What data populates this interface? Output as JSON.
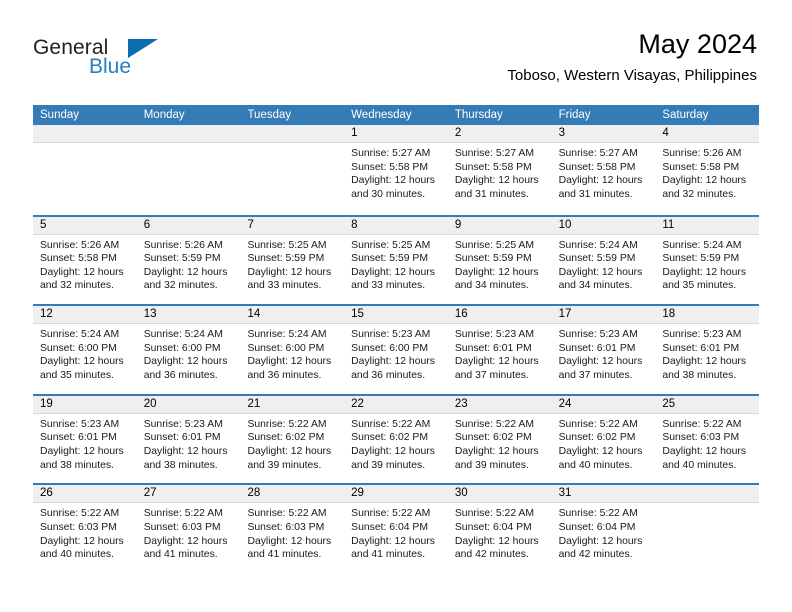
{
  "logo": {
    "word_top": "General",
    "word_bottom": "Blue",
    "accent_color": "#0b6cb0",
    "text_color": "#231f20"
  },
  "header": {
    "title": "May 2024",
    "subtitle": "Toboso, Western Visayas, Philippines"
  },
  "theme": {
    "header_blue": "#357cb6",
    "band_gray": "#efefef"
  },
  "weekdays": [
    "Sunday",
    "Monday",
    "Tuesday",
    "Wednesday",
    "Thursday",
    "Friday",
    "Saturday"
  ],
  "weeks": [
    [
      {
        "day": "",
        "sunrise": "",
        "sunset": "",
        "daylight": "",
        "daylight2": ""
      },
      {
        "day": "",
        "sunrise": "",
        "sunset": "",
        "daylight": "",
        "daylight2": ""
      },
      {
        "day": "",
        "sunrise": "",
        "sunset": "",
        "daylight": "",
        "daylight2": ""
      },
      {
        "day": "1",
        "sunrise": "Sunrise: 5:27 AM",
        "sunset": "Sunset: 5:58 PM",
        "daylight": "Daylight: 12 hours",
        "daylight2": "and 30 minutes."
      },
      {
        "day": "2",
        "sunrise": "Sunrise: 5:27 AM",
        "sunset": "Sunset: 5:58 PM",
        "daylight": "Daylight: 12 hours",
        "daylight2": "and 31 minutes."
      },
      {
        "day": "3",
        "sunrise": "Sunrise: 5:27 AM",
        "sunset": "Sunset: 5:58 PM",
        "daylight": "Daylight: 12 hours",
        "daylight2": "and 31 minutes."
      },
      {
        "day": "4",
        "sunrise": "Sunrise: 5:26 AM",
        "sunset": "Sunset: 5:58 PM",
        "daylight": "Daylight: 12 hours",
        "daylight2": "and 32 minutes."
      }
    ],
    [
      {
        "day": "5",
        "sunrise": "Sunrise: 5:26 AM",
        "sunset": "Sunset: 5:58 PM",
        "daylight": "Daylight: 12 hours",
        "daylight2": "and 32 minutes."
      },
      {
        "day": "6",
        "sunrise": "Sunrise: 5:26 AM",
        "sunset": "Sunset: 5:59 PM",
        "daylight": "Daylight: 12 hours",
        "daylight2": "and 32 minutes."
      },
      {
        "day": "7",
        "sunrise": "Sunrise: 5:25 AM",
        "sunset": "Sunset: 5:59 PM",
        "daylight": "Daylight: 12 hours",
        "daylight2": "and 33 minutes."
      },
      {
        "day": "8",
        "sunrise": "Sunrise: 5:25 AM",
        "sunset": "Sunset: 5:59 PM",
        "daylight": "Daylight: 12 hours",
        "daylight2": "and 33 minutes."
      },
      {
        "day": "9",
        "sunrise": "Sunrise: 5:25 AM",
        "sunset": "Sunset: 5:59 PM",
        "daylight": "Daylight: 12 hours",
        "daylight2": "and 34 minutes."
      },
      {
        "day": "10",
        "sunrise": "Sunrise: 5:24 AM",
        "sunset": "Sunset: 5:59 PM",
        "daylight": "Daylight: 12 hours",
        "daylight2": "and 34 minutes."
      },
      {
        "day": "11",
        "sunrise": "Sunrise: 5:24 AM",
        "sunset": "Sunset: 5:59 PM",
        "daylight": "Daylight: 12 hours",
        "daylight2": "and 35 minutes."
      }
    ],
    [
      {
        "day": "12",
        "sunrise": "Sunrise: 5:24 AM",
        "sunset": "Sunset: 6:00 PM",
        "daylight": "Daylight: 12 hours",
        "daylight2": "and 35 minutes."
      },
      {
        "day": "13",
        "sunrise": "Sunrise: 5:24 AM",
        "sunset": "Sunset: 6:00 PM",
        "daylight": "Daylight: 12 hours",
        "daylight2": "and 36 minutes."
      },
      {
        "day": "14",
        "sunrise": "Sunrise: 5:24 AM",
        "sunset": "Sunset: 6:00 PM",
        "daylight": "Daylight: 12 hours",
        "daylight2": "and 36 minutes."
      },
      {
        "day": "15",
        "sunrise": "Sunrise: 5:23 AM",
        "sunset": "Sunset: 6:00 PM",
        "daylight": "Daylight: 12 hours",
        "daylight2": "and 36 minutes."
      },
      {
        "day": "16",
        "sunrise": "Sunrise: 5:23 AM",
        "sunset": "Sunset: 6:01 PM",
        "daylight": "Daylight: 12 hours",
        "daylight2": "and 37 minutes."
      },
      {
        "day": "17",
        "sunrise": "Sunrise: 5:23 AM",
        "sunset": "Sunset: 6:01 PM",
        "daylight": "Daylight: 12 hours",
        "daylight2": "and 37 minutes."
      },
      {
        "day": "18",
        "sunrise": "Sunrise: 5:23 AM",
        "sunset": "Sunset: 6:01 PM",
        "daylight": "Daylight: 12 hours",
        "daylight2": "and 38 minutes."
      }
    ],
    [
      {
        "day": "19",
        "sunrise": "Sunrise: 5:23 AM",
        "sunset": "Sunset: 6:01 PM",
        "daylight": "Daylight: 12 hours",
        "daylight2": "and 38 minutes."
      },
      {
        "day": "20",
        "sunrise": "Sunrise: 5:23 AM",
        "sunset": "Sunset: 6:01 PM",
        "daylight": "Daylight: 12 hours",
        "daylight2": "and 38 minutes."
      },
      {
        "day": "21",
        "sunrise": "Sunrise: 5:22 AM",
        "sunset": "Sunset: 6:02 PM",
        "daylight": "Daylight: 12 hours",
        "daylight2": "and 39 minutes."
      },
      {
        "day": "22",
        "sunrise": "Sunrise: 5:22 AM",
        "sunset": "Sunset: 6:02 PM",
        "daylight": "Daylight: 12 hours",
        "daylight2": "and 39 minutes."
      },
      {
        "day": "23",
        "sunrise": "Sunrise: 5:22 AM",
        "sunset": "Sunset: 6:02 PM",
        "daylight": "Daylight: 12 hours",
        "daylight2": "and 39 minutes."
      },
      {
        "day": "24",
        "sunrise": "Sunrise: 5:22 AM",
        "sunset": "Sunset: 6:02 PM",
        "daylight": "Daylight: 12 hours",
        "daylight2": "and 40 minutes."
      },
      {
        "day": "25",
        "sunrise": "Sunrise: 5:22 AM",
        "sunset": "Sunset: 6:03 PM",
        "daylight": "Daylight: 12 hours",
        "daylight2": "and 40 minutes."
      }
    ],
    [
      {
        "day": "26",
        "sunrise": "Sunrise: 5:22 AM",
        "sunset": "Sunset: 6:03 PM",
        "daylight": "Daylight: 12 hours",
        "daylight2": "and 40 minutes."
      },
      {
        "day": "27",
        "sunrise": "Sunrise: 5:22 AM",
        "sunset": "Sunset: 6:03 PM",
        "daylight": "Daylight: 12 hours",
        "daylight2": "and 41 minutes."
      },
      {
        "day": "28",
        "sunrise": "Sunrise: 5:22 AM",
        "sunset": "Sunset: 6:03 PM",
        "daylight": "Daylight: 12 hours",
        "daylight2": "and 41 minutes."
      },
      {
        "day": "29",
        "sunrise": "Sunrise: 5:22 AM",
        "sunset": "Sunset: 6:04 PM",
        "daylight": "Daylight: 12 hours",
        "daylight2": "and 41 minutes."
      },
      {
        "day": "30",
        "sunrise": "Sunrise: 5:22 AM",
        "sunset": "Sunset: 6:04 PM",
        "daylight": "Daylight: 12 hours",
        "daylight2": "and 42 minutes."
      },
      {
        "day": "31",
        "sunrise": "Sunrise: 5:22 AM",
        "sunset": "Sunset: 6:04 PM",
        "daylight": "Daylight: 12 hours",
        "daylight2": "and 42 minutes."
      },
      {
        "day": "",
        "sunrise": "",
        "sunset": "",
        "daylight": "",
        "daylight2": ""
      }
    ]
  ]
}
